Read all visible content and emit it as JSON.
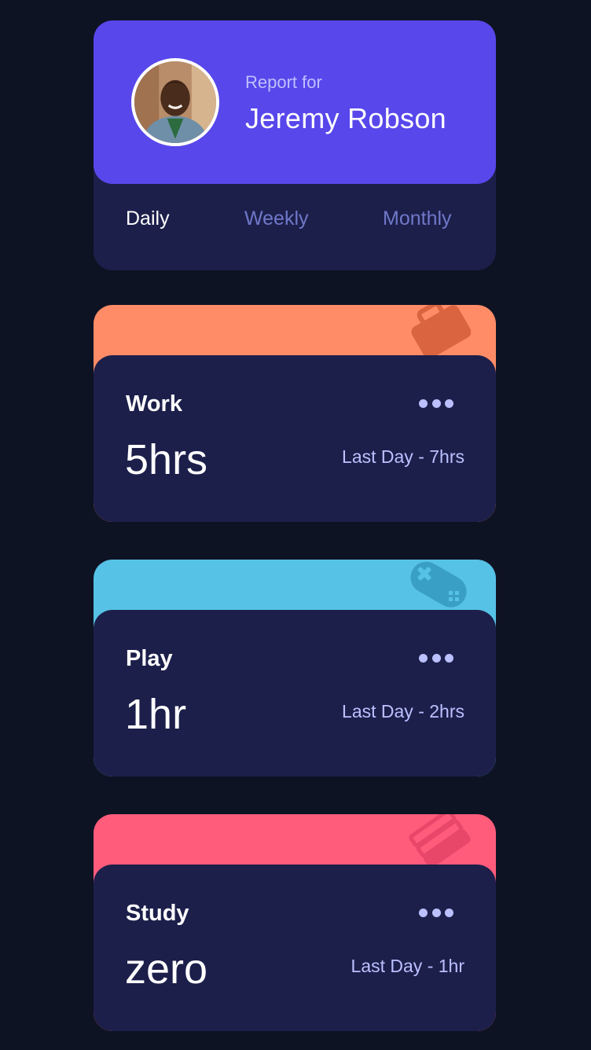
{
  "profile": {
    "report_for": "Report for",
    "name": "Jeremy Robson",
    "avatar": "user-avatar-photo"
  },
  "tabs": [
    {
      "label": "Daily",
      "active": true
    },
    {
      "label": "Weekly",
      "active": false
    },
    {
      "label": "Monthly",
      "active": false
    }
  ],
  "activities": [
    {
      "title": "Work",
      "current": "5hrs",
      "previous": "Last Day - 7hrs",
      "color": "#ff8c66",
      "icon": "briefcase-icon"
    },
    {
      "title": "Play",
      "current": "1hr",
      "previous": "Last Day - 2hrs",
      "color": "#56c2e6",
      "icon": "gamepad-icon"
    },
    {
      "title": "Study",
      "current": "zero",
      "previous": "Last Day - 1hr",
      "color": "#ff5c7c",
      "icon": "books-icon"
    }
  ],
  "theme": {
    "background": "#0e1323",
    "card": "#1c1f4a",
    "accent": "#5847eb"
  }
}
